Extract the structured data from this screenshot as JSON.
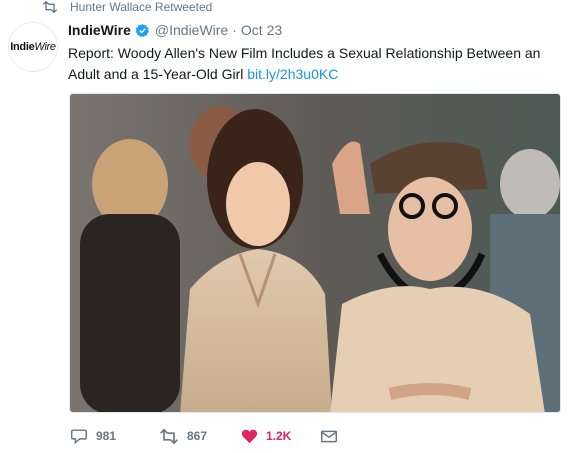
{
  "retweet_context": {
    "icon": "retweet-icon",
    "text": "Hunter Wallace Retweeted"
  },
  "author": {
    "avatar_logo_text": "IndieWire",
    "display_name": "IndieWire",
    "verified": true,
    "handle": "@IndieWire",
    "separator": "·",
    "date": "Oct 23"
  },
  "tweet": {
    "text": "Report: Woody Allen's New Film Includes a Sexual Relationship Between an Adult and a 15-Year-Old Girl",
    "link": "bit.ly/2h3u0KC"
  },
  "media": {
    "type": "photo"
  },
  "actions": {
    "reply": {
      "icon": "reply-icon",
      "count": "981"
    },
    "retweet": {
      "icon": "retweet-icon",
      "count": "867"
    },
    "like": {
      "icon": "heart-icon",
      "count": "1.2K",
      "liked": true
    },
    "message": {
      "icon": "envelope-icon"
    }
  },
  "colors": {
    "link": "#1b95e0",
    "secondary_text": "#657786",
    "like": "#e0245e",
    "verified": "#1da1f2"
  }
}
